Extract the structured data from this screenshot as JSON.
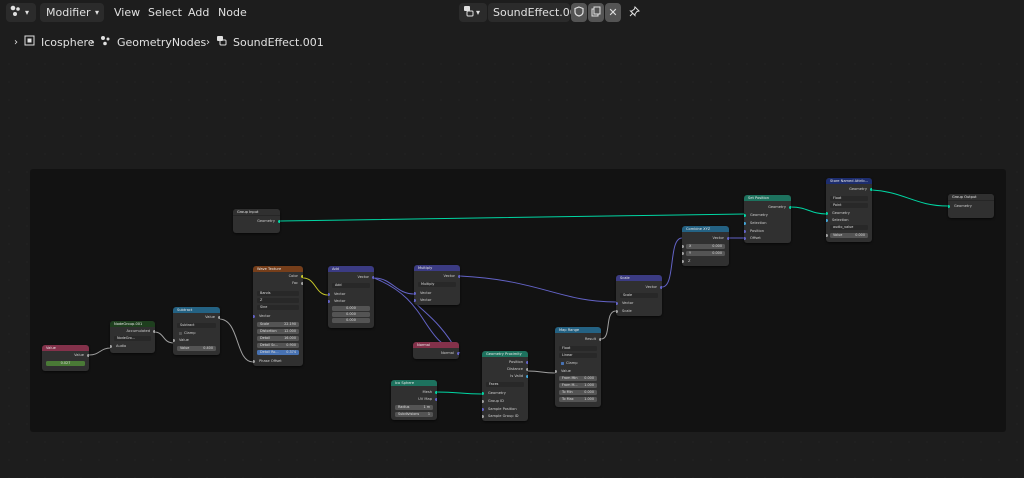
{
  "header": {
    "editor_type_icon": "geometry-nodes-icon",
    "mode": "Modifier",
    "menus": [
      "View",
      "Select",
      "Add",
      "Node"
    ],
    "node_tree_name": "SoundEffect.001"
  },
  "breadcrumb": [
    "Icosphere",
    "GeometryNodes",
    "SoundEffect.001"
  ],
  "colors": {
    "geometry_socket": "#00d6a3",
    "vector_socket": "#6363c7",
    "float_socket": "#a1a1a1",
    "geometry_node_header": "#1d725e",
    "vector_node_header": "#3b3b83",
    "converter_node_header": "#246283",
    "texture_node_header": "#763e1a",
    "input_node_header": "#83314a",
    "group_node_header": "#1e3f1e"
  },
  "nodes": {
    "value": {
      "title": "Value",
      "output": "Value",
      "value": "0.027"
    },
    "node_group": {
      "title": "NodeGroup.001",
      "output": "Accumulated",
      "datablock": "NodeGro...",
      "input": "Audio"
    },
    "subtract": {
      "title": "Subtract",
      "output": "Value",
      "op": "Subtract",
      "clamp": "Clamp",
      "in1": "Value",
      "in2_label": "Value",
      "in2_value": "0.400"
    },
    "wave": {
      "title": "Wave Texture",
      "out1": "Color",
      "out2": "Fac",
      "type": "Bands",
      "dir": "Z",
      "profile": "Sine",
      "vector": "Vector",
      "fields": [
        [
          "Scale",
          "22.190"
        ],
        [
          "Distortion",
          "12.000"
        ],
        [
          "Detail",
          "16.000"
        ],
        [
          "Detail Sc...",
          "0.900"
        ],
        [
          "Detail Ro...",
          "0.374"
        ]
      ],
      "phase": "Phase Offset"
    },
    "add": {
      "title": "Add",
      "output": "Vector",
      "op": "Add",
      "in1": "Vector",
      "in2": "Vector",
      "vals": [
        "0.000",
        "0.000",
        "0.000"
      ]
    },
    "multiply": {
      "title": "Multiply",
      "output": "Vector",
      "op": "Multiply",
      "in1": "Vector",
      "in2": "Vector"
    },
    "normal": {
      "title": "Normal",
      "output": "Normal"
    },
    "group_input": {
      "title": "Group Input",
      "output": "Geometry"
    },
    "ico_sphere": {
      "title": "Ico Sphere",
      "out1": "Mesh",
      "out2": "UV Map",
      "radius_label": "Radius",
      "radius": "1 m",
      "subdiv_label": "Subdivisions",
      "subdiv": "1"
    },
    "geo_prox": {
      "title": "Geometry Proximity",
      "out1": "Position",
      "out2": "Distance",
      "out3": "Is Valid",
      "mode": "Faces",
      "in1": "Geometry",
      "in2": "Group ID",
      "in3": "Sample Position",
      "in4": "Sample Group ID"
    },
    "map_range": {
      "title": "Map Range",
      "output": "Result",
      "dtype": "Float",
      "interp": "Linear",
      "clamp": "Clamp",
      "in_value": "Value",
      "fields": [
        [
          "From Min",
          "0.000"
        ],
        [
          "From M...",
          "1.000"
        ],
        [
          "To Min",
          "0.000"
        ],
        [
          "To Max",
          "1.000"
        ]
      ]
    },
    "scale": {
      "title": "Scale",
      "output": "Vector",
      "op": "Scale",
      "in1": "Vector",
      "in2": "Scale"
    },
    "combine": {
      "title": "Combine XYZ",
      "output": "Vector",
      "x_label": "X",
      "x": "0.000",
      "y_label": "Y",
      "y": "0.000",
      "z": "Z"
    },
    "set_position": {
      "title": "Set Position",
      "output": "Geometry",
      "in1": "Geometry",
      "in2": "Selection",
      "in3": "Position",
      "in4": "Offset"
    },
    "store_attr": {
      "title": "Store Named Attrib...",
      "output": "Geometry",
      "dtype": "Float",
      "domain": "Point",
      "in1": "Geometry",
      "in2": "Selection",
      "name": "audio_value",
      "value_label": "Value",
      "value": "0.000"
    },
    "group_output": {
      "title": "Group Output",
      "input": "Geometry"
    }
  }
}
